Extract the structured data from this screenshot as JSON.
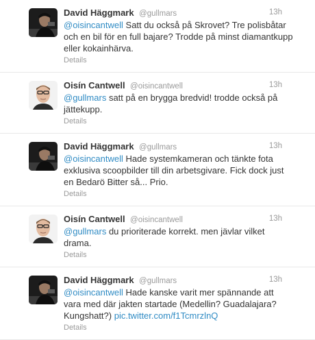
{
  "tweets": [
    {
      "author": "David Häggmark",
      "handle": "@gullmars",
      "time": "13h",
      "avatar_icon": "profile-photo-dark",
      "mention": "@oisincantwell",
      "text": " Satt du också på Skrovet? Tre polisbåtar och en bil för en full bajare? Trodde på minst diamantkupp eller kokainhärva.",
      "link": "",
      "details": "Details"
    },
    {
      "author": "Oisín Cantwell",
      "handle": "@oisincantwell",
      "time": "13h",
      "avatar_icon": "profile-photo-light",
      "mention": "@gullmars",
      "text": " satt på en brygga bredvid! trodde också på jättekupp.",
      "link": "",
      "details": "Details"
    },
    {
      "author": "David Häggmark",
      "handle": "@gullmars",
      "time": "13h",
      "avatar_icon": "profile-photo-dark",
      "mention": "@oisincantwell",
      "text": " Hade systemkameran och tänkte fota exklusiva scoopbilder till din arbetsgivare. Fick dock just en Bedarö Bitter så... Prio.",
      "link": "",
      "details": "Details"
    },
    {
      "author": "Oisín Cantwell",
      "handle": "@oisincantwell",
      "time": "13h",
      "avatar_icon": "profile-photo-light",
      "mention": "@gullmars",
      "text": " du prioriterade korrekt. men jävlar vilket drama.",
      "link": "",
      "details": "Details"
    },
    {
      "author": "David Häggmark",
      "handle": "@gullmars",
      "time": "13h",
      "avatar_icon": "profile-photo-dark",
      "mention": "@oisincantwell",
      "text": " Hade kanske varit mer spännande att vara med där jakten startade (Medellin? Guadalajara? Kungshatt?) ",
      "link": "pic.twitter.com/f1TcmrzlnQ",
      "details": "Details"
    }
  ],
  "colors": {
    "link": "#2f8bc4",
    "meta": "#999999",
    "text": "#333333",
    "divider": "#e8e8e8"
  }
}
